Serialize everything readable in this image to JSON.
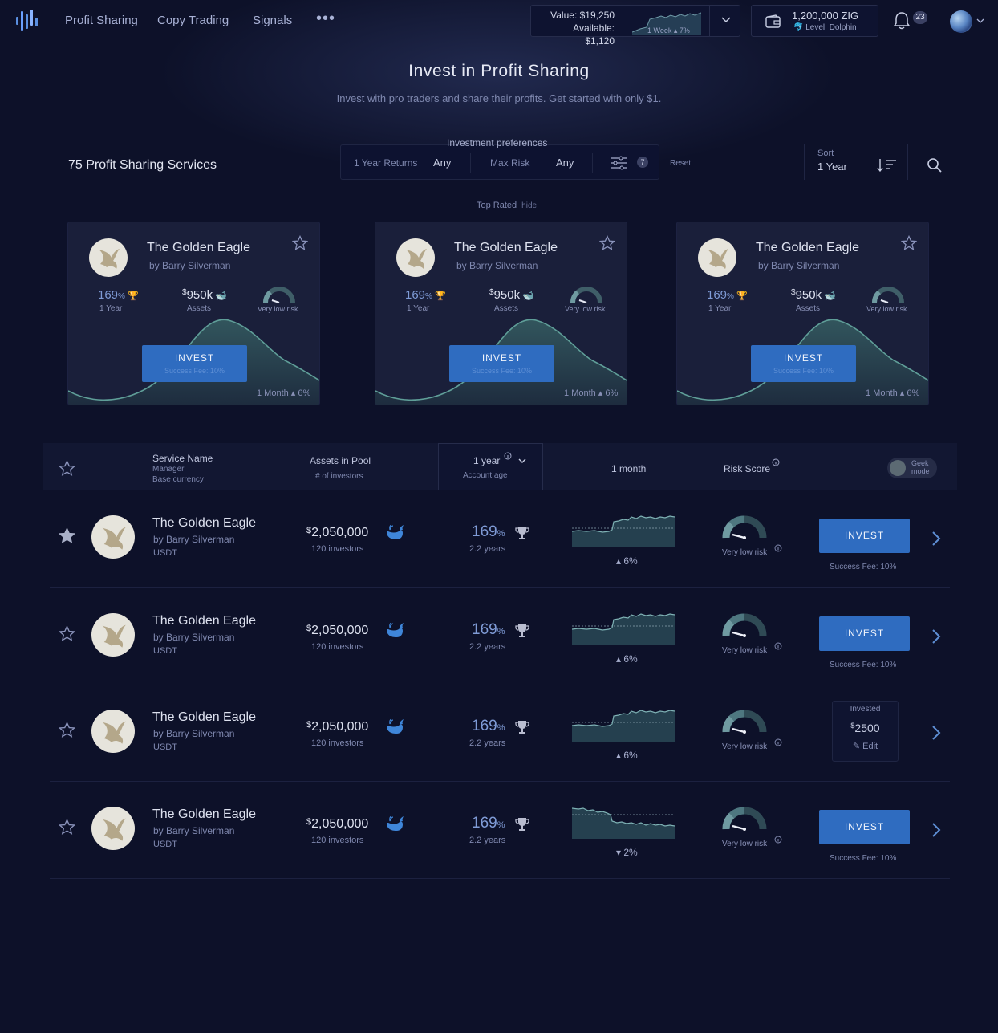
{
  "nav": {
    "links": [
      "Profit Sharing",
      "Copy Trading",
      "Signals"
    ],
    "more_icon": "more-dots-icon"
  },
  "wallet": {
    "value": "Value: $19,250",
    "available": "Available: $1,120",
    "week_change": "1 Week ▴ 7%"
  },
  "zig": {
    "amount": "1,200,000 ZIG",
    "level": "Level: Dolphin"
  },
  "notifications": {
    "count": "23"
  },
  "hero": {
    "title": "Invest in Profit Sharing",
    "subtitle": "Invest with pro traders and share their profits. Get started with only $1."
  },
  "filters": {
    "count_label": "75 Profit Sharing Services",
    "prefs_label": "Investment preferences",
    "returns_label": "1 Year Returns",
    "returns_value": "Any",
    "risk_label": "Max Risk",
    "risk_value": "Any",
    "active_count": "7",
    "reset": "Reset",
    "sort_label": "Sort",
    "sort_value": "1 Year"
  },
  "top_rated": {
    "label": "Top Rated",
    "hide": "hide"
  },
  "featured": [
    {
      "name": "The Golden Eagle",
      "manager": "by Barry Silverman",
      "return": "169",
      "return_unit": "%",
      "return_period": "1 Year",
      "assets": "950k",
      "assets_prefix": "$",
      "assets_label": "Assets",
      "risk": "Very low risk",
      "cta": "INVEST",
      "fee": "Success Fee: 10%",
      "month": "1 Month ▴ 6%"
    },
    {
      "name": "The Golden Eagle",
      "manager": "by Barry Silverman",
      "return": "169",
      "return_unit": "%",
      "return_period": "1 Year",
      "assets": "950k",
      "assets_prefix": "$",
      "assets_label": "Assets",
      "risk": "Very low risk",
      "cta": "INVEST",
      "fee": "Success Fee: 10%",
      "month": "1 Month ▴ 6%"
    },
    {
      "name": "The Golden Eagle",
      "manager": "by Barry Silverman",
      "return": "169",
      "return_unit": "%",
      "return_period": "1 Year",
      "assets": "950k",
      "assets_prefix": "$",
      "assets_label": "Assets",
      "risk": "Very low risk",
      "cta": "INVEST",
      "fee": "Success Fee: 10%",
      "month": "1 Month ▴ 6%"
    }
  ],
  "table": {
    "col_service": "Service Name",
    "col_manager": "Manager",
    "col_currency": "Base currency",
    "col_assets": "Assets in Pool",
    "col_investors": "# of investors",
    "col_year": "1 year",
    "col_account_age": "Account age",
    "col_month": "1 month",
    "col_risk": "Risk Score",
    "geek_mode": "Geek mode"
  },
  "rows": [
    {
      "favorited": true,
      "name": "The Golden Eagle",
      "manager": "by Barry Silverman",
      "currency": "USDT",
      "assets_prefix": "$",
      "assets": "2,050,000",
      "investors": "120 investors",
      "return": "169",
      "return_unit": "%",
      "age": "2.2 years",
      "change": "▴ 6%",
      "trend": "up",
      "risk": "Very low risk",
      "cta": "INVEST",
      "fee": "Success Fee: 10%"
    },
    {
      "favorited": false,
      "name": "The Golden Eagle",
      "manager": "by Barry Silverman",
      "currency": "USDT",
      "assets_prefix": "$",
      "assets": "2,050,000",
      "investors": "120 investors",
      "return": "169",
      "return_unit": "%",
      "age": "2.2 years",
      "change": "▴ 6%",
      "trend": "up",
      "risk": "Very low risk",
      "cta": "INVEST",
      "fee": "Success Fee: 10%"
    },
    {
      "favorited": false,
      "name": "The Golden Eagle",
      "manager": "by Barry Silverman",
      "currency": "USDT",
      "assets_prefix": "$",
      "assets": "2,050,000",
      "investors": "120 investors",
      "return": "169",
      "return_unit": "%",
      "age": "2.2 years",
      "change": "▴ 6%",
      "trend": "up",
      "risk": "Very low risk",
      "invested_label": "Invested",
      "invested_prefix": "$",
      "invested_amount": "2500",
      "edit": "Edit"
    },
    {
      "favorited": false,
      "name": "The Golden Eagle",
      "manager": "by Barry Silverman",
      "currency": "USDT",
      "assets_prefix": "$",
      "assets": "2,050,000",
      "investors": "120 investors",
      "return": "169",
      "return_unit": "%",
      "age": "2.2 years",
      "change": "▾ 2%",
      "trend": "down",
      "risk": "Very low risk",
      "cta": "INVEST",
      "fee": "Success Fee: 10%"
    }
  ],
  "colors": {
    "background": "#0d1129",
    "accent": "#2f6cc0",
    "card": "#1a1f3a",
    "teal": "#3f7370"
  }
}
